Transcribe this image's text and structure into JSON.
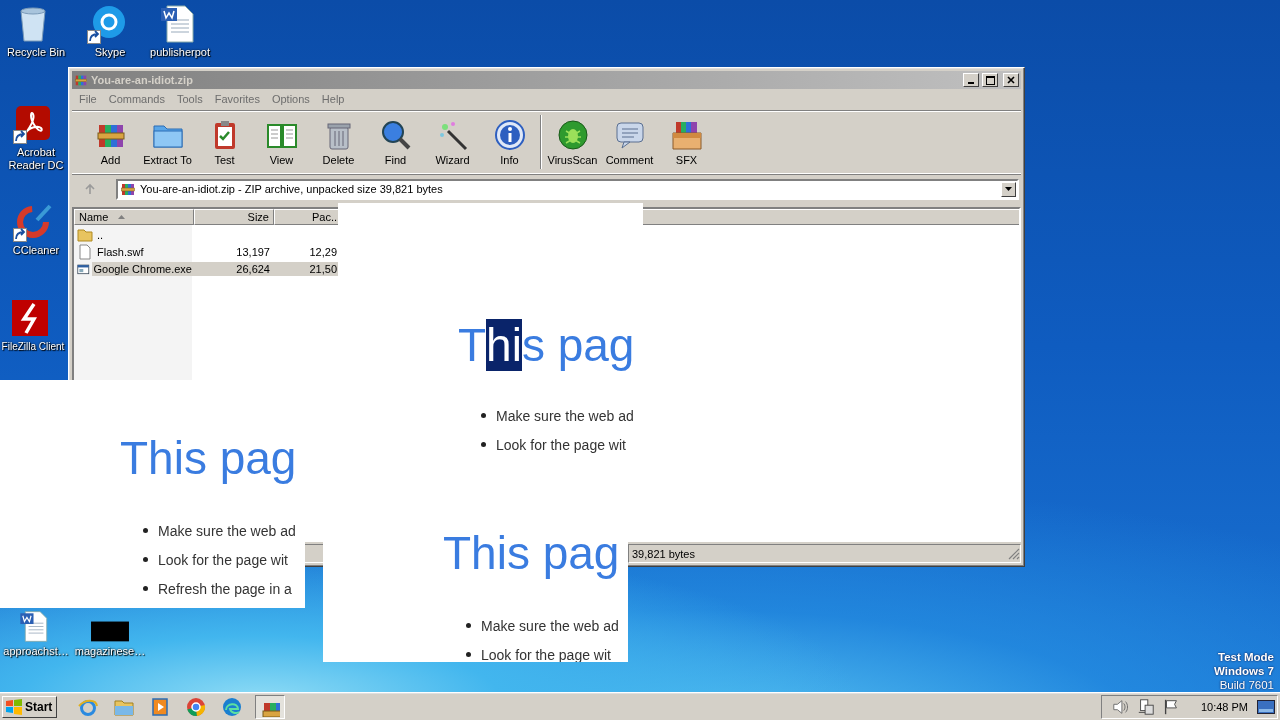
{
  "desktop": {
    "icons": [
      {
        "label": "Recycle Bin",
        "kind": "recycle",
        "shortcut": false
      },
      {
        "label": "Skype",
        "kind": "skype",
        "shortcut": true
      },
      {
        "label": "publisherpot",
        "kind": "word",
        "shortcut": false
      },
      {
        "label": "Acrobat Reader DC",
        "kind": "acrobat",
        "shortcut": true
      },
      {
        "label": "CCleaner",
        "kind": "ccleaner",
        "shortcut": true
      },
      {
        "label": "FileZilla Client",
        "kind": "filezilla",
        "shortcut": false
      },
      {
        "label": "approachst…",
        "kind": "word",
        "shortcut": false
      },
      {
        "label": "magazinese…",
        "kind": "blank",
        "shortcut": false
      }
    ],
    "system_notice": [
      "Test Mode",
      "Windows 7",
      "Build 7601"
    ]
  },
  "archive_window": {
    "title": "You-are-an-idiot.zip",
    "active": false,
    "menu": [
      "File",
      "Commands",
      "Tools",
      "Favorites",
      "Options",
      "Help"
    ],
    "toolbar": [
      {
        "label": "Add",
        "kind": "add"
      },
      {
        "label": "Extract To",
        "kind": "extract"
      },
      {
        "label": "Test",
        "kind": "test"
      },
      {
        "label": "View",
        "kind": "view"
      },
      {
        "label": "Delete",
        "kind": "delete"
      },
      {
        "label": "Find",
        "kind": "find"
      },
      {
        "label": "Wizard",
        "kind": "wizard"
      },
      {
        "label": "Info",
        "kind": "info"
      },
      {
        "label": "VirusScan",
        "kind": "virusscan"
      },
      {
        "label": "Comment",
        "kind": "comment"
      },
      {
        "label": "SFX",
        "kind": "sfx"
      }
    ],
    "address": "You-are-an-idiot.zip - ZIP archive, unpacked size 39,821 bytes",
    "columns": [
      {
        "label": "Name",
        "sorted": true
      },
      {
        "label": "Size",
        "sorted": false
      },
      {
        "label": "Pac..",
        "sorted": false
      }
    ],
    "rows": [
      {
        "kind": "folder",
        "name": "..",
        "selected": false
      },
      {
        "kind": "file",
        "name": "Flash.swf",
        "size": "13,197",
        "packed": "12,29",
        "selected": false
      },
      {
        "kind": "exe",
        "name": "Google Chrome.exe",
        "size": "26,624",
        "packed": "21,50",
        "selected": true
      }
    ],
    "status": "39,821 bytes"
  },
  "page_fragments": [
    {
      "title": [
        {
          "text": "T",
          "selected": false
        },
        {
          "text": "hi",
          "selected": true
        },
        {
          "text": "s pag",
          "selected": false
        }
      ],
      "bullets": [
        "Make sure the web ad",
        "Look for the page wit"
      ]
    },
    {
      "title": [
        {
          "text": "This pag",
          "selected": false
        }
      ],
      "bullets": [
        "Make sure the web ad",
        "Look for the page wit",
        "Refresh the page in a"
      ]
    },
    {
      "title": [
        {
          "text": "This pag",
          "selected": false
        }
      ],
      "bullets": [
        "Make sure the web ad",
        "Look for the page wit"
      ]
    }
  ],
  "taskbar": {
    "start": "Start",
    "apps": [
      {
        "kind": "ie",
        "active": false
      },
      {
        "kind": "explorer",
        "active": false
      },
      {
        "kind": "media",
        "active": false
      },
      {
        "kind": "chrome",
        "active": false
      },
      {
        "kind": "edge",
        "active": false
      },
      {
        "kind": "winrar",
        "active": true
      }
    ],
    "tray": {
      "clock": "10:48 PM"
    }
  }
}
